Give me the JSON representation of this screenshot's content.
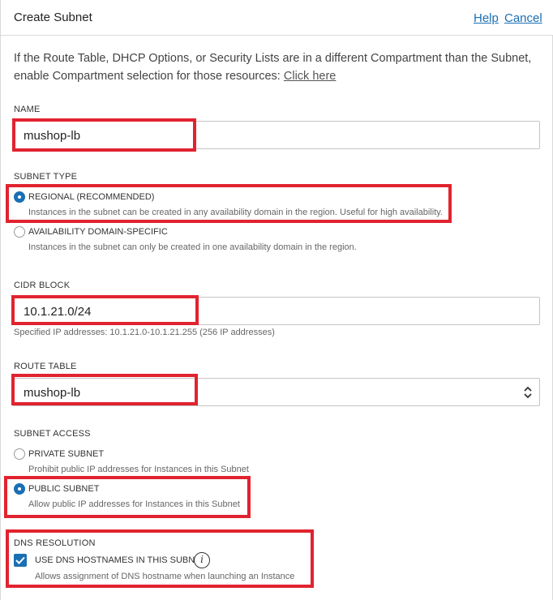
{
  "header": {
    "title": "Create Subnet",
    "help_label": "Help",
    "cancel_label": "Cancel"
  },
  "intro": {
    "text": "If the Route Table, DHCP Options, or Security Lists are in a different Compartment than the Subnet, enable Compartment selection for those resources:",
    "link_label": "Click here"
  },
  "name": {
    "label": "NAME",
    "value": "mushop-lb"
  },
  "subnet_type": {
    "label": "SUBNET TYPE",
    "options": [
      {
        "label": "REGIONAL (RECOMMENDED)",
        "description": "Instances in the subnet can be created in any availability domain in the region. Useful for high availability.",
        "selected": true
      },
      {
        "label": "AVAILABILITY DOMAIN-SPECIFIC",
        "description": "Instances in the subnet can only be created in one availability domain in the region.",
        "selected": false
      }
    ]
  },
  "cidr": {
    "label": "CIDR BLOCK",
    "value": "10.1.21.0/24",
    "help": "Specified IP addresses: 10.1.21.0-10.1.21.255 (256 IP addresses)"
  },
  "route_table": {
    "label": "ROUTE TABLE",
    "value": "mushop-lb"
  },
  "subnet_access": {
    "label": "SUBNET ACCESS",
    "options": [
      {
        "label": "PRIVATE SUBNET",
        "description": "Prohibit public IP addresses for Instances in this Subnet",
        "selected": false
      },
      {
        "label": "PUBLIC SUBNET",
        "description": "Allow public IP addresses for Instances in this Subnet",
        "selected": true
      }
    ]
  },
  "dns": {
    "label": "DNS RESOLUTION",
    "checkbox_label": "USE DNS HOSTNAMES IN THIS SUBNET",
    "checked": true,
    "description": "Allows assignment of DNS hostname when launching an Instance"
  },
  "colors": {
    "accent": "#1a6fb3",
    "highlight": "#e1232f"
  }
}
